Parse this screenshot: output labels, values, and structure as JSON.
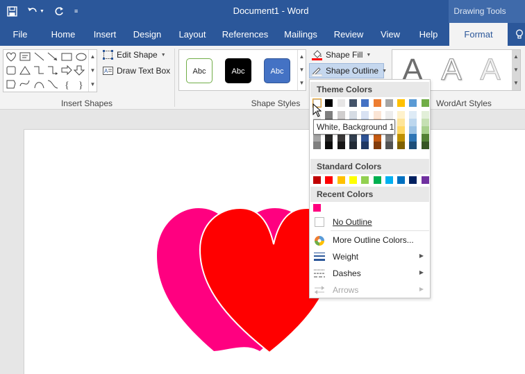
{
  "title_bar": {
    "document_title": "Document1  -  Word",
    "context_tab": "Drawing Tools",
    "qat": {
      "save_icon": "save-icon",
      "undo_icon": "undo-icon",
      "redo_icon": "redo-icon",
      "customize_icon": "customize-qat-icon"
    }
  },
  "tabs": [
    {
      "label": "File"
    },
    {
      "label": "Home"
    },
    {
      "label": "Insert"
    },
    {
      "label": "Design"
    },
    {
      "label": "Layout"
    },
    {
      "label": "References"
    },
    {
      "label": "Mailings"
    },
    {
      "label": "Review"
    },
    {
      "label": "View"
    },
    {
      "label": "Help"
    },
    {
      "label": "Format"
    }
  ],
  "ribbon": {
    "insert_shapes": {
      "label": "Insert Shapes",
      "edit_shape": "Edit Shape",
      "draw_text_box": "Draw Text Box"
    },
    "shape_styles": {
      "label": "Shape Styles",
      "swatches": [
        {
          "text": "Abc",
          "fill": "#ffffff",
          "border": "#70ad47",
          "color": "#222222"
        },
        {
          "text": "Abc",
          "fill": "#000000",
          "border": "#000000",
          "color": "#ffffff"
        },
        {
          "text": "Abc",
          "fill": "#4472c4",
          "border": "#2f5597",
          "color": "#ffffff"
        }
      ],
      "shape_fill": "Shape Fill",
      "shape_outline": "Shape Outline"
    },
    "wordart_styles": {
      "label": "WordArt Styles",
      "letters": [
        "A",
        "A",
        "A"
      ]
    }
  },
  "menu": {
    "theme_colors_header": "Theme Colors",
    "standard_colors_header": "Standard Colors",
    "recent_colors_header": "Recent Colors",
    "theme_top_row": [
      "#ffffff",
      "#000000",
      "#e7e6e6",
      "#44546a",
      "#4472c4",
      "#ed7d31",
      "#a5a5a5",
      "#ffc000",
      "#5b9bd5",
      "#70ad47"
    ],
    "theme_shades": [
      [
        "#f2f2f2",
        "#7f7f7f",
        "#d0cece",
        "#d6dce4",
        "#d9e2f3",
        "#fbe5d5",
        "#ededed",
        "#fff2cc",
        "#deebf6",
        "#e2efd9"
      ],
      [
        "#d8d8d8",
        "#595959",
        "#aeabab",
        "#adb9ca",
        "#b4c6e7",
        "#f7cbac",
        "#dbdbdb",
        "#fee599",
        "#bdd7ee",
        "#c5e0b3"
      ],
      [
        "#bfbfbf",
        "#3f3f3f",
        "#757070",
        "#8496b0",
        "#8eaadb",
        "#f4b183",
        "#c9c9c9",
        "#ffd965",
        "#9cc3e5",
        "#a8d08d"
      ],
      [
        "#a5a5a5",
        "#262626",
        "#3a3838",
        "#323f4f",
        "#2f5496",
        "#c55a11",
        "#7b7b7b",
        "#bf9000",
        "#2e75b5",
        "#538135"
      ],
      [
        "#7f7f7f",
        "#0c0c0c",
        "#171616",
        "#222a35",
        "#1f3864",
        "#833c0b",
        "#525252",
        "#7f6000",
        "#1e4e79",
        "#375623"
      ]
    ],
    "standard_colors": [
      "#c00000",
      "#ff0000",
      "#ffc000",
      "#ffff00",
      "#92d050",
      "#00b050",
      "#00b0f0",
      "#0070c0",
      "#002060",
      "#7030a0"
    ],
    "recent_colors": [
      "#ff007f"
    ],
    "items": {
      "no_outline": "No Outline",
      "more_colors": "More Outline Colors...",
      "weight": "Weight",
      "dashes": "Dashes",
      "arrows": "Arrows"
    },
    "tooltip": "White, Background 1"
  },
  "canvas": {
    "hearts": [
      {
        "name": "pink-heart",
        "color": "#ff0080"
      },
      {
        "name": "red-heart",
        "color": "#ff0000"
      }
    ]
  }
}
